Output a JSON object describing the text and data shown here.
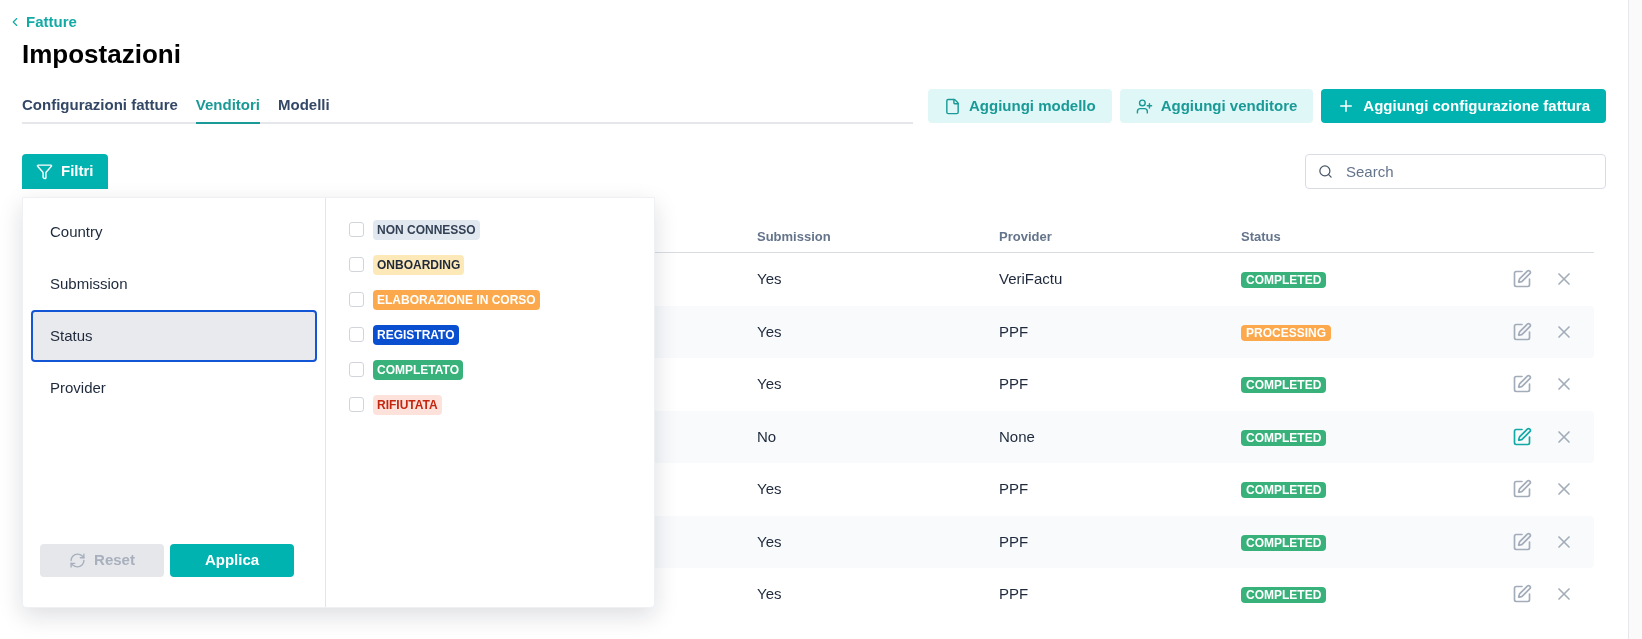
{
  "breadcrumb": {
    "label": "Fatture"
  },
  "title": "Impostazioni",
  "tabs": [
    {
      "label": "Configurazioni fatture",
      "selected": false
    },
    {
      "label": "Venditori",
      "selected": true
    },
    {
      "label": "Modelli",
      "selected": false
    }
  ],
  "actions": [
    {
      "label": "Aggiungi modello",
      "kind": "template"
    },
    {
      "label": "Aggiungi venditore",
      "kind": "seller"
    },
    {
      "label": "Aggiungi configurazione fattura",
      "kind": "primary"
    }
  ],
  "filter_button": {
    "label": "Filtri"
  },
  "search": {
    "placeholder": "Search"
  },
  "filter_panel": {
    "categories": [
      {
        "label": "Country",
        "selected": false
      },
      {
        "label": "Submission",
        "selected": false
      },
      {
        "label": "Status",
        "selected": true
      },
      {
        "label": "Provider",
        "selected": false
      }
    ],
    "options": [
      {
        "label": "NON CONNESSO",
        "kind": "neutral",
        "checked": false
      },
      {
        "label": "ONBOARDING",
        "kind": "pending",
        "checked": false
      },
      {
        "label": "ELABORAZIONE IN CORSO",
        "kind": "processing",
        "checked": false
      },
      {
        "label": "REGISTRATO",
        "kind": "registered",
        "checked": false
      },
      {
        "label": "COMPLETATO",
        "kind": "completed",
        "checked": false
      },
      {
        "label": "RIFIUTATA",
        "kind": "rejected",
        "checked": false
      }
    ],
    "reset": {
      "label": "Reset",
      "disabled": true
    },
    "apply": {
      "label": "Applica"
    }
  },
  "table": {
    "columns": [
      "Submission",
      "Provider",
      "Status"
    ],
    "rows": [
      {
        "submission": "Yes",
        "provider": "VeriFactu",
        "status": "COMPLETED",
        "color": "#38b27a",
        "edit_hovered": false
      },
      {
        "submission": "Yes",
        "provider": "PPF",
        "status": "PROCESSING",
        "color": "#fba94c",
        "edit_hovered": false
      },
      {
        "submission": "Yes",
        "provider": "PPF",
        "status": "COMPLETED",
        "color": "#38b27a",
        "edit_hovered": false
      },
      {
        "submission": "No",
        "provider": "None",
        "status": "COMPLETED",
        "color": "#38b27a",
        "edit_hovered": true
      },
      {
        "submission": "Yes",
        "provider": "PPF",
        "status": "COMPLETED",
        "color": "#38b27a",
        "edit_hovered": false
      },
      {
        "submission": "Yes",
        "provider": "PPF",
        "status": "COMPLETED",
        "color": "#38b27a",
        "edit_hovered": false
      },
      {
        "submission": "Yes",
        "provider": "PPF",
        "status": "COMPLETED",
        "color": "#38b27a",
        "edit_hovered": false
      }
    ]
  }
}
